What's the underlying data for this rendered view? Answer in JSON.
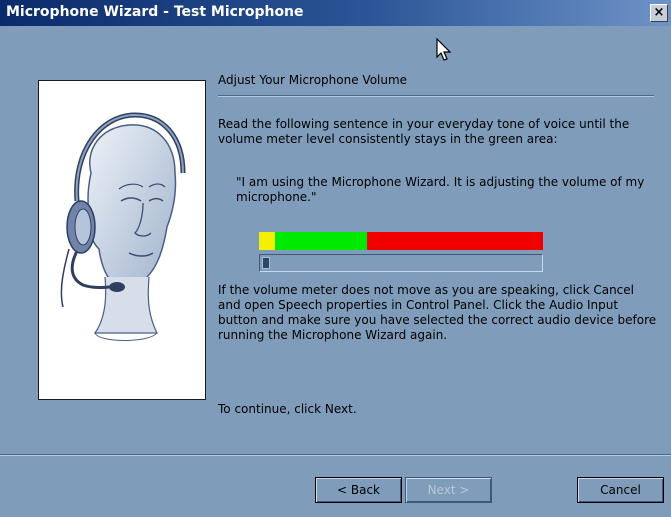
{
  "window": {
    "title": "Microphone Wizard - Test Microphone",
    "close_label": "×"
  },
  "content": {
    "heading": "Adjust Your Microphone Volume",
    "instruction": "Read the following sentence in your everyday tone of voice until the volume meter level consistently stays in the green area:",
    "quote": "\"I am using the Microphone Wizard.  It is adjusting the volume of my microphone.\"",
    "troubleshoot": "If the volume meter does not move as you are speaking, click Cancel and open Speech properties in Control Panel.  Click the Audio Input button and make sure you have selected the correct audio device before running the Microphone Wizard again.",
    "continue_hint": "To continue, click Next."
  },
  "volume_meter": {
    "zones": [
      {
        "name": "low",
        "color": "#f4f000"
      },
      {
        "name": "good",
        "color": "#00ea00"
      },
      {
        "name": "high",
        "color": "#f00000"
      }
    ],
    "current_level": 0.02
  },
  "buttons": {
    "back": "< Back",
    "next": "Next >",
    "cancel": "Cancel"
  },
  "icons": {
    "image": "headset-head-illustration",
    "close": "close-icon",
    "cursor": "mouse-pointer-icon"
  }
}
